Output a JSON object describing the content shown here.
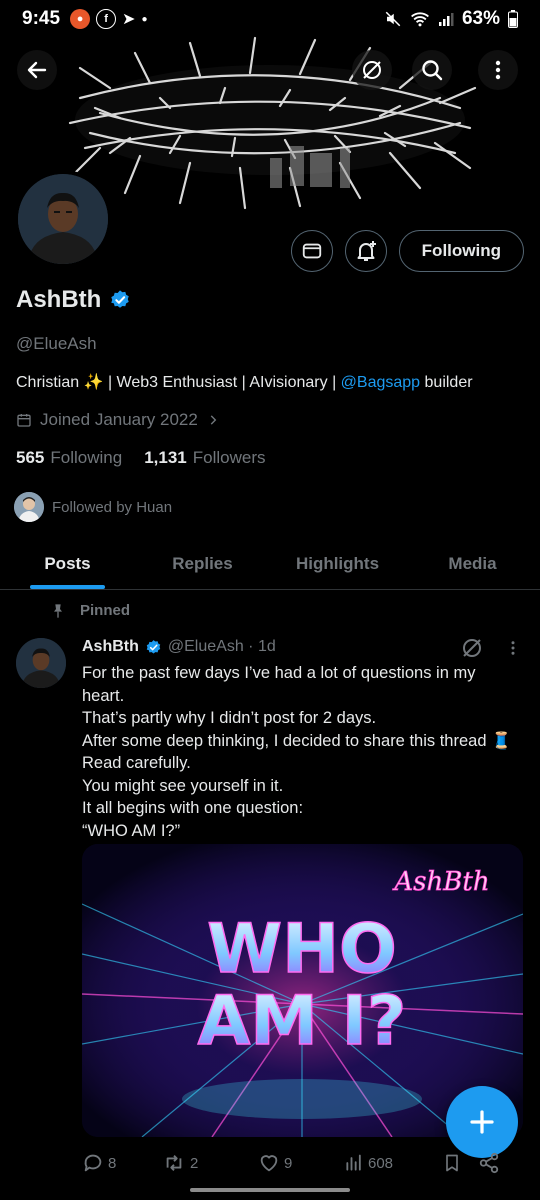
{
  "status_bar": {
    "time": "9:45",
    "battery": "63%"
  },
  "profile": {
    "name": "AshBth",
    "handle": "@ElueAsh",
    "bio_prefix": "Christian ✨ | Web3 Enthusiast | AIvisionary | ",
    "bio_mention": "@Bagsapp",
    "bio_suffix": " builder",
    "joined": "Joined January 2022",
    "following_count": "565",
    "following_label": "Following",
    "followers_count": "1,131",
    "followers_label": "Followers",
    "followed_by": "Followed by Huan",
    "follow_button": "Following"
  },
  "tabs": [
    "Posts",
    "Replies",
    "Highlights",
    "Media"
  ],
  "post": {
    "pinned_label": "Pinned",
    "author": "AshBth",
    "handle_time": "@ElueAsh · 1d",
    "lines": [
      "For the past few days I’ve had a lot of questions in my",
      "heart.",
      "That’s partly why I didn’t post for 2 days.",
      "After some deep thinking, I decided to share this thread 🧵",
      "Read carefully.",
      "You might see yourself in it.",
      "It all begins with one question:",
      "“WHO AM I?”"
    ],
    "image_text_line1": "WHO",
    "image_text_line2": "AM I?",
    "image_signature": "AshBth",
    "replies": "8",
    "reposts": "2",
    "likes": "9",
    "views": "608"
  },
  "colors": {
    "accent": "#1d9bf0",
    "secondary_text": "#71767b",
    "background": "#000000"
  }
}
